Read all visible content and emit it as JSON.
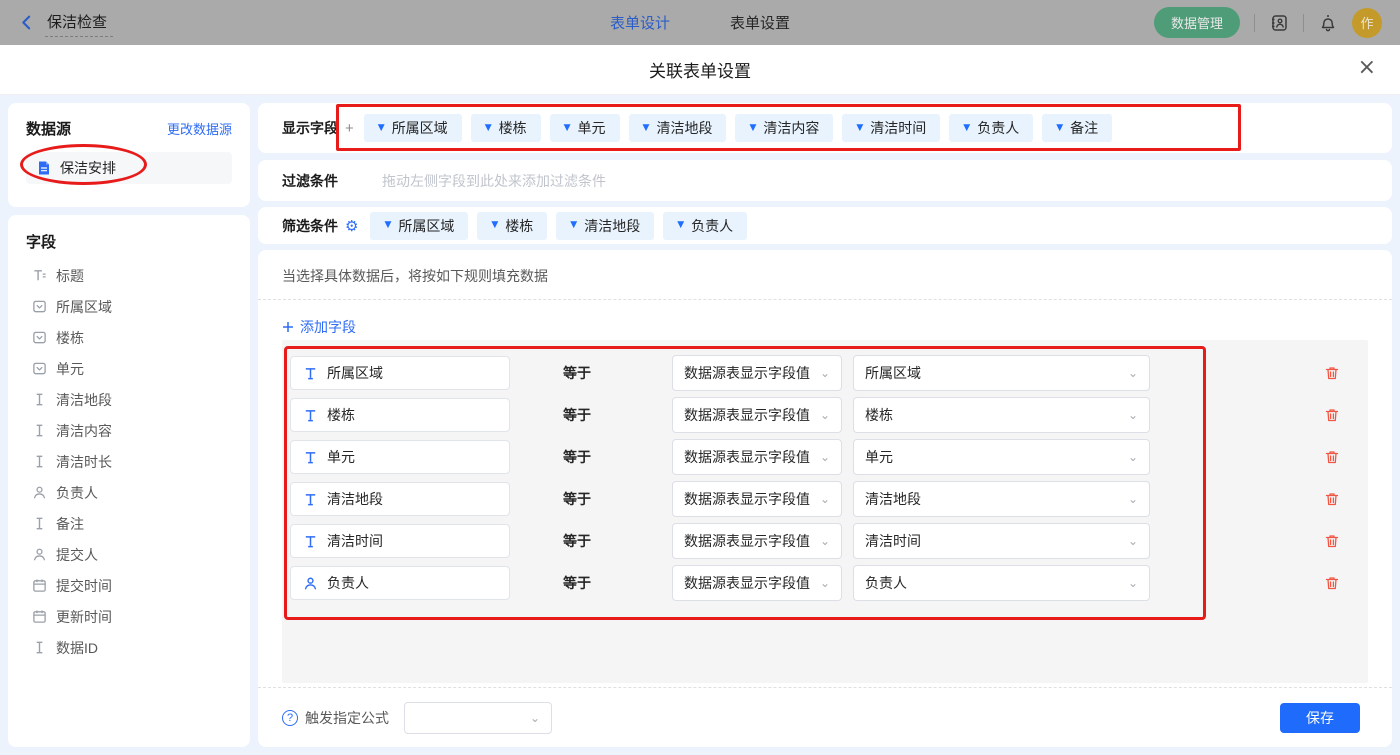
{
  "topbar": {
    "back_label": "保洁检查",
    "tabs": [
      {
        "label": "表单设计",
        "active": true
      },
      {
        "label": "表单设置",
        "active": false
      }
    ],
    "data_manage_label": "数据管理",
    "avatar_text": "作"
  },
  "modal": {
    "title": "关联表单设置",
    "close": "×"
  },
  "datasource": {
    "title": "数据源",
    "change_link": "更改数据源",
    "item": "保洁安排"
  },
  "fields": {
    "title": "字段",
    "items": [
      {
        "icon": "title-field",
        "label": "标题"
      },
      {
        "icon": "select-field",
        "label": "所属区域"
      },
      {
        "icon": "select-field",
        "label": "楼栋"
      },
      {
        "icon": "select-field",
        "label": "单元"
      },
      {
        "icon": "text-field",
        "label": "清洁地段"
      },
      {
        "icon": "text-field",
        "label": "清洁内容"
      },
      {
        "icon": "text-field",
        "label": "清洁时长"
      },
      {
        "icon": "person",
        "label": "负责人"
      },
      {
        "icon": "text-field",
        "label": "备注"
      },
      {
        "icon": "person",
        "label": "提交人"
      },
      {
        "icon": "calendar",
        "label": "提交时间"
      },
      {
        "icon": "calendar",
        "label": "更新时间"
      },
      {
        "icon": "text-field",
        "label": "数据ID"
      }
    ]
  },
  "display_fields": {
    "label": "显示字段",
    "add": "+",
    "tags": [
      "所属区域",
      "楼栋",
      "单元",
      "清洁地段",
      "清洁内容",
      "清洁时间",
      "负责人",
      "备注"
    ]
  },
  "filter": {
    "label": "过滤条件",
    "placeholder": "拖动左侧字段到此处来添加过滤条件"
  },
  "screen": {
    "label": "筛选条件",
    "gear": "⚙",
    "tags": [
      "所属区域",
      "楼栋",
      "清洁地段",
      "负责人"
    ]
  },
  "rules": {
    "hint": "当选择具体数据后，将按如下规则填充数据",
    "add_field_label": "添加字段",
    "equals": "等于",
    "source_option": "数据源表显示字段值",
    "rows": [
      {
        "icon": "text-input",
        "field": "所属区域",
        "value": "所属区域"
      },
      {
        "icon": "text-input",
        "field": "楼栋",
        "value": "楼栋"
      },
      {
        "icon": "text-input",
        "field": "单元",
        "value": "单元"
      },
      {
        "icon": "text-input",
        "field": "清洁地段",
        "value": "清洁地段"
      },
      {
        "icon": "text-input",
        "field": "清洁时间",
        "value": "清洁时间"
      },
      {
        "icon": "person-blue",
        "field": "负责人",
        "value": "负责人"
      }
    ]
  },
  "footer": {
    "formula_label": "触发指定公式",
    "help": "?",
    "save_label": "保存"
  },
  "colors": {
    "accent_blue": "#2e6cf6",
    "tag_bg": "#e8f3fe",
    "annotation_red": "#e81b1b",
    "save_blue": "#1f6bfb",
    "trash_red": "#f25643",
    "pill_green_dimmed": "#4e9c78",
    "avatar_gold_dimmed": "#c49b2b"
  }
}
